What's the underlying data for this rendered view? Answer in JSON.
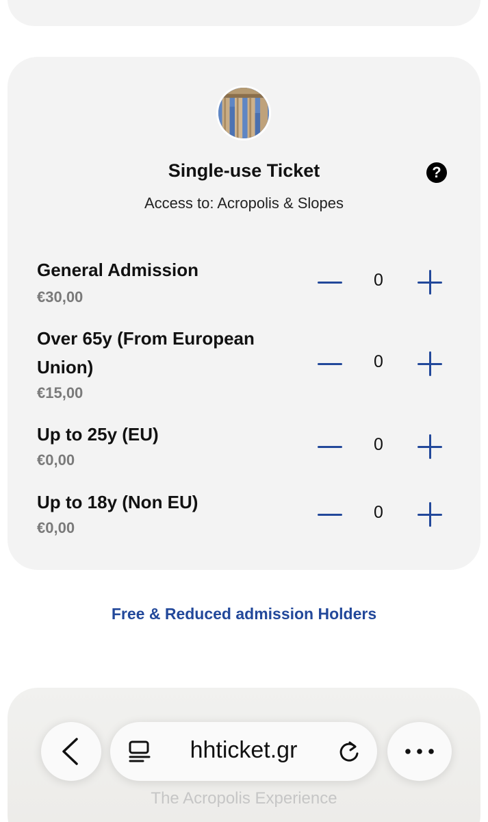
{
  "ticket": {
    "title": "Single-use Ticket",
    "subtitle": "Access to: Acropolis & Slopes",
    "help_glyph": "?",
    "rows": [
      {
        "name": "General Admission",
        "price": "€30,00",
        "quantity": "0"
      },
      {
        "name": "Over 65y (From European Union)",
        "price": "€15,00",
        "quantity": "0"
      },
      {
        "name": "Up to 25y (EU)",
        "price": "€0,00",
        "quantity": "0"
      },
      {
        "name": "Up to 18y (Non EU)",
        "price": "€0,00",
        "quantity": "0"
      }
    ]
  },
  "free_link": "Free & Reduced admission Holders",
  "footer_caption": "The Acropolis Experience",
  "browser": {
    "url": "hhticket.gr",
    "icons": [
      "back-icon",
      "tabs-icon",
      "reload-icon",
      "more-icon"
    ]
  },
  "colors": {
    "accent": "#22489a",
    "card_bg": "#f3f3f3",
    "price_gray": "#7a7a7a"
  }
}
